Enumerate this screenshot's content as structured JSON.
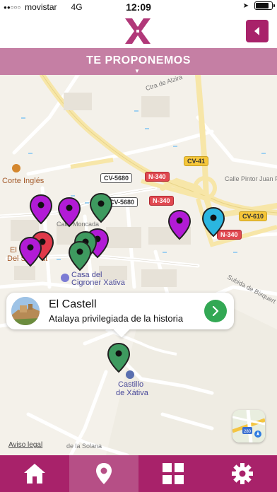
{
  "status_bar": {
    "signal": "●●○○○",
    "carrier": "movistar",
    "network": "4G",
    "time": "12:09",
    "battery_level": 0.85
  },
  "header": {
    "logo_icon": "x-ornament-logo",
    "back_icon": "back-arrow-icon",
    "accent_color": "#a8226a"
  },
  "title_bar": {
    "title": "TE PROPONEMOS",
    "caret": "▼"
  },
  "map": {
    "street_labels": [
      "Ctra de Alzira",
      "Calle Moncada",
      "Calle Pintor Juan Francés",
      "Subida de Bixquert",
      "de la Solana"
    ],
    "road_shields": {
      "cv5680_a": "CV-5680",
      "cv5680_b": "CV-5680",
      "n340_a": "N-340",
      "n340_b": "N-340",
      "n340_c": "N-340",
      "cv41": "CV-41",
      "cv610": "CV-610"
    },
    "poi": {
      "corte_ingles": "Corte Inglés",
      "el_del": "El",
      "del_s": "Del S",
      "at": "at",
      "casa_del": "Casa del",
      "cigroner": "Cigroner Xativa",
      "castillo": "Castillo",
      "de_xativa": "de Xátiva"
    },
    "pin_colors": {
      "purple": "#b21bd6",
      "green": "#3e9a5f",
      "cyan": "#2bb6e0",
      "red": "#e0394a"
    },
    "legal_link": "Aviso legal",
    "maps_icon": "apple-maps-icon"
  },
  "callout": {
    "title": "El Castell",
    "subtitle": "Atalaya privilegiada de la historia",
    "go_icon": "chevron-right-icon",
    "go_color": "#33a854"
  },
  "tab_bar": {
    "tabs": [
      {
        "name": "home",
        "icon": "home-icon",
        "active": false
      },
      {
        "name": "map",
        "icon": "location-pin-icon",
        "active": true
      },
      {
        "name": "grid",
        "icon": "grid-icon",
        "active": false
      },
      {
        "name": "settings",
        "icon": "gear-icon",
        "active": false
      }
    ]
  }
}
